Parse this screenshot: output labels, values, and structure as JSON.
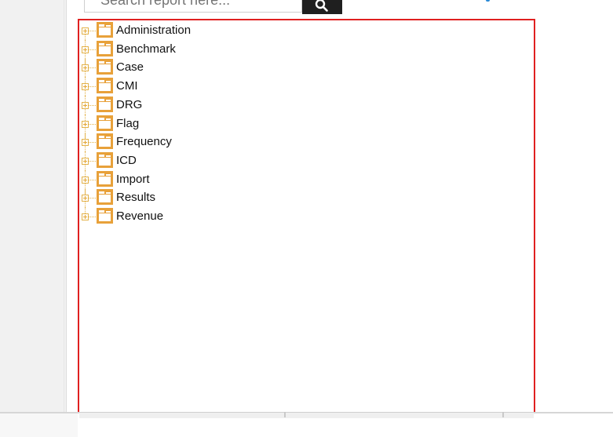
{
  "search": {
    "placeholder": "Search report here..."
  },
  "colors": {
    "accent_folder": "#e8a13a",
    "panel_border": "#e02020",
    "search_button_bg": "#1f1f1f"
  },
  "icons": {
    "search_button": "magnifier-icon",
    "node_expander": "plus-box-icon",
    "node_icon": "folder-icon"
  },
  "tree": {
    "nodes": [
      {
        "label": "Administration"
      },
      {
        "label": "Benchmark"
      },
      {
        "label": "Case"
      },
      {
        "label": "CMI"
      },
      {
        "label": "DRG"
      },
      {
        "label": "Flag"
      },
      {
        "label": "Frequency"
      },
      {
        "label": "ICD"
      },
      {
        "label": "Import"
      },
      {
        "label": "Results"
      },
      {
        "label": "Revenue"
      }
    ]
  }
}
